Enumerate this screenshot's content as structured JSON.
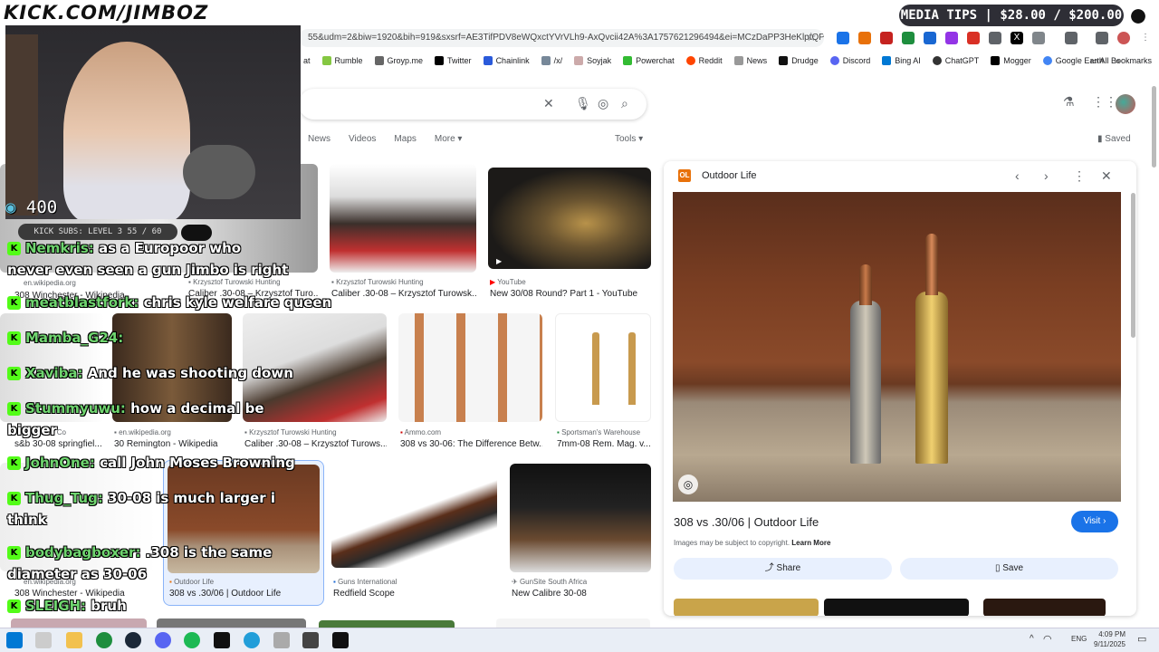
{
  "overlay": {
    "logo_text": "KICK.COM/JIMBOZ",
    "media_tips": "MEDIA TIPS | $28.00 / $200.00",
    "viewer_count": "400",
    "kick_subs": "KICK SUBS: LEVEL 3 55 / 60"
  },
  "browser": {
    "url": "55&udm=2&biw=1920&bih=919&sxsrf=AE3TifPDV8eWQxctYVrVLh9-AxQvcii42A%3A1757621296494&ei=MCzDaPP3HeKlptQPi4...",
    "bookmarks": [
      "at",
      "Rumble",
      "Groyp.me",
      "Twitter",
      "Chainlink",
      "/x/",
      "Soyjak",
      "Powerchat",
      "Reddit",
      "News",
      "Drudge",
      "Discord",
      "Bing AI",
      "ChatGPT",
      "Mogger",
      "Google Earth"
    ],
    "all_bookmarks": "All Bookmarks",
    "more": "»"
  },
  "search": {
    "nav": [
      "News",
      "Videos",
      "Maps",
      "More ▾"
    ],
    "tools": "Tools ▾",
    "saved": "Saved"
  },
  "results": [
    {
      "source": "en.wikipedia.org",
      "title": "308 Winchester - Wikipedia"
    },
    {
      "source": "Krzysztof Turowski Hunting",
      "title": "Caliber .30-08 – Krzysztof Turo..."
    },
    {
      "source": "Krzysztof Turowski Hunting",
      "title": "Caliber .30-08 – Krzysztof Turowsk..."
    },
    {
      "source": "YouTube",
      "title": "New 30/08 Round? Part 1 - YouTube"
    },
    {
      "source": "Weston & Co",
      "title": "s&b 30-08 springfiel..."
    },
    {
      "source": "en.wikipedia.org",
      "title": "30 Remington - Wikipedia"
    },
    {
      "source": "Krzysztof Turowski Hunting",
      "title": "Caliber .30-08 – Krzysztof Turows..."
    },
    {
      "source": "Ammo.com",
      "title": "308 vs 30-06: The Difference Betw..."
    },
    {
      "source": "Sportsman's Warehouse",
      "title": "7mm-08 Rem. Mag. v..."
    },
    {
      "source": "en.wikipedia.org",
      "title": "308 Winchester - Wikipedia"
    },
    {
      "source": "Outdoor Life",
      "title": "308 vs .30/06 | Outdoor Life"
    },
    {
      "source": "Guns International",
      "title": "Redfield Scope"
    },
    {
      "source": "GunSite South Africa",
      "title": "New Calibre 30-08"
    }
  ],
  "panel": {
    "site": "Outdoor Life",
    "title": "308 vs .30/06 | Outdoor Life",
    "visit": "Visit ›",
    "copyright": "Images may be subject to copyright.",
    "learn_more": "Learn More",
    "share": "Share",
    "save": "Save"
  },
  "chat": [
    {
      "user": "Nemkris:",
      "msg": " as a Europoor who"
    },
    {
      "user": "",
      "msg": "never even seen a gun Jimbo is right"
    },
    {
      "user": "meatblastfork:",
      "msg": " chris kyle welfare queen"
    },
    {
      "user": "Mamba_G24:",
      "msg": ""
    },
    {
      "user": "Xaviba:",
      "msg": " And he was shooting down"
    },
    {
      "user": "Stummyuwu:",
      "msg": " how a decimal be"
    },
    {
      "user": "",
      "msg": "bigger"
    },
    {
      "user": "JohnOne:",
      "msg": " call John Moses Browning"
    },
    {
      "user": "Thug_Tug:",
      "msg": " 30-08 is much larger i"
    },
    {
      "user": "",
      "msg": "think"
    },
    {
      "user": "bodybagboxer:",
      "msg": " .308 is the same"
    },
    {
      "user": "",
      "msg": "diameter as 30-06"
    },
    {
      "user": "SLEIGH:",
      "msg": " bruh"
    }
  ],
  "taskbar": {
    "lang": "ENG",
    "time": "4:09 PM",
    "date": "9/11/2025"
  },
  "chart_colors": {
    "accent": "#1a73e8",
    "kick": "#53fc18"
  }
}
